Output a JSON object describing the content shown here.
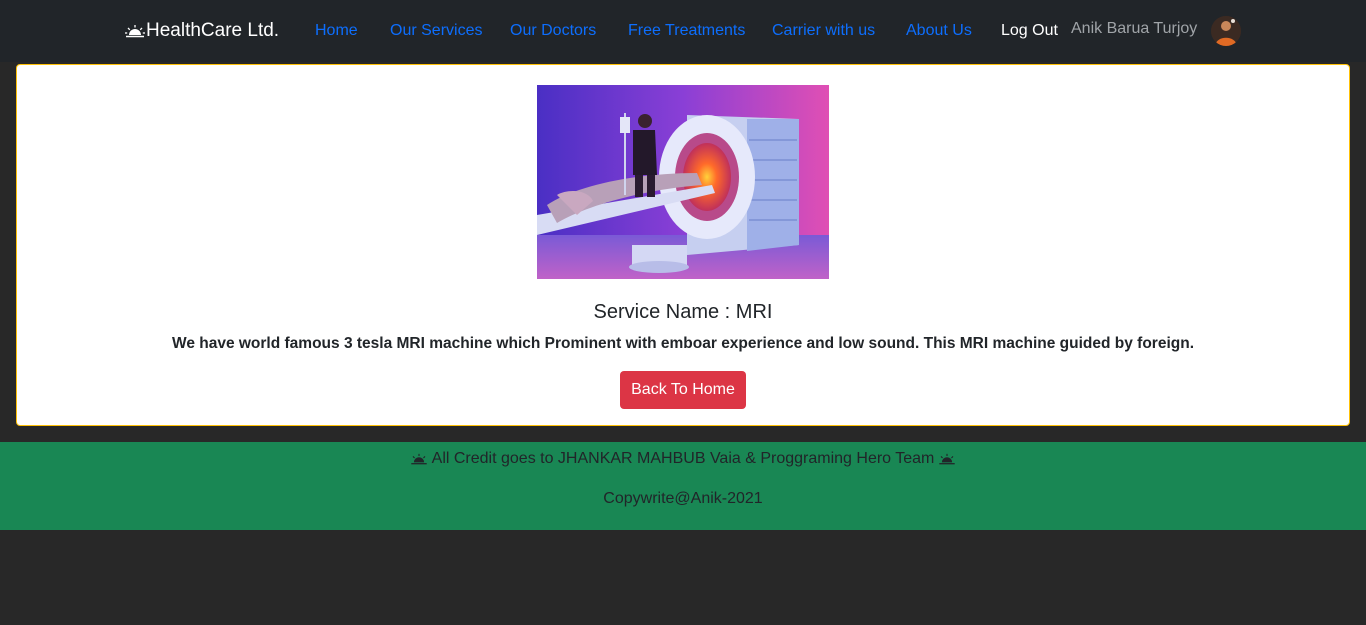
{
  "navbar": {
    "brand": "HealthCare Ltd.",
    "links": [
      "Home",
      "Our Services",
      "Our Doctors",
      "Free Treatments",
      "Carrier with us",
      "About Us"
    ],
    "logout": "Log Out",
    "username": "Anik Barua Turjoy"
  },
  "service": {
    "title": "Service Name : MRI",
    "description": "We have world famous 3 tesla MRI machine which Prominent with emboar experience and low sound. This MRI machine guided by foreign.",
    "button": "Back To Home"
  },
  "footer": {
    "credit": "All Credit goes to JHANKAR MAHBUB Vaia & Proggraming Hero Team",
    "copyright": "Copywrite@Anik-2021"
  },
  "colors": {
    "navbar": "#212529",
    "link": "#0d6efd",
    "button": "#dc3545",
    "footer": "#198754",
    "card_border": "#ffc107"
  }
}
